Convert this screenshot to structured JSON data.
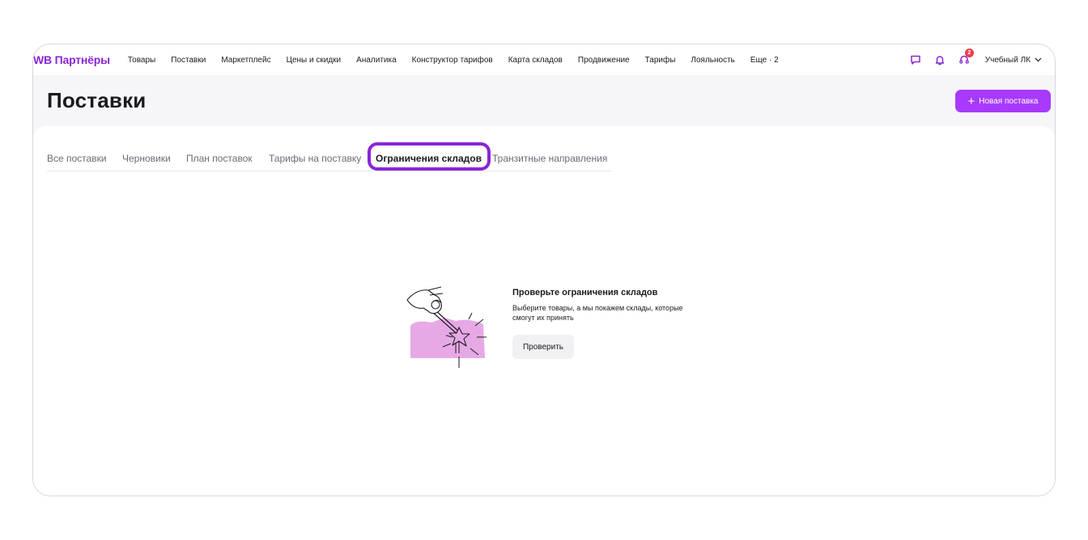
{
  "app": {
    "logo": "WB Партнёры"
  },
  "nav": {
    "items": [
      "Товары",
      "Поставки",
      "Маркетплейс",
      "Цены и скидки",
      "Аналитика",
      "Конструктор тарифов",
      "Карта складов",
      "Продвижение",
      "Тарифы",
      "Лояльность",
      "Еще · 2"
    ]
  },
  "header_icons": {
    "chat": "chat-icon",
    "bell": "bell-icon",
    "support": "support-icon",
    "support_badge": "2"
  },
  "account": {
    "label": "Учебный ЛК",
    "chevron": "chevron-down-icon"
  },
  "page": {
    "title": "Поставки",
    "new_button": "Новая поставка",
    "new_button_icon": "plus-icon"
  },
  "tabs": [
    {
      "label": "Все поставки"
    },
    {
      "label": "Черновики"
    },
    {
      "label": "План поставок"
    },
    {
      "label": "Тарифы на поставку"
    },
    {
      "label": "Ограничения складов",
      "active": true
    },
    {
      "label": "Транзитные направления"
    }
  ],
  "empty_state": {
    "title": "Проверьте ограничения складов",
    "description": "Выберите товары, а мы покажем склады, которые смогут их принять",
    "button": "Проверить"
  },
  "colors": {
    "accent": "#a73afd",
    "logo": "#8a25d6",
    "highlight": "#8a25d6",
    "illustration": "#e7a9e6"
  }
}
